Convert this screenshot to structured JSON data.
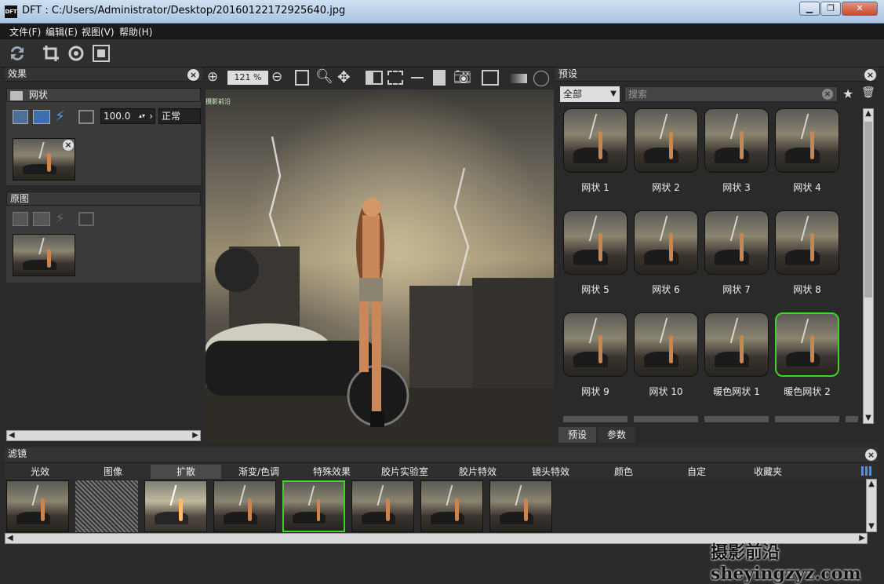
{
  "window": {
    "title": "DFT : C:/Users/Administrator/Desktop/20160122172925640.jpg",
    "app_logo": "DFT",
    "min_label": "▁",
    "max_label": "❐",
    "close_label": "✕"
  },
  "menu": [
    "文件(F)",
    "编辑(E)",
    "视图(V)",
    "帮助(H)"
  ],
  "effects_panel": {
    "title": "效果",
    "layer1": {
      "name": "网状",
      "opacity": "100.0",
      "blend": "正常"
    },
    "layer2": {
      "name": "原图"
    }
  },
  "viewer": {
    "zoom": "121 %",
    "watermark": "摄影前沿"
  },
  "presets_panel": {
    "title": "预设",
    "filter_selected": "全部",
    "search_placeholder": "搜索",
    "items": [
      {
        "label": "网状 1"
      },
      {
        "label": "网状 2"
      },
      {
        "label": "网状 3"
      },
      {
        "label": "网状 4"
      },
      {
        "label": "网状 5"
      },
      {
        "label": "网状 6"
      },
      {
        "label": "网状 7"
      },
      {
        "label": "网状 8"
      },
      {
        "label": "网状 9"
      },
      {
        "label": "网状 10"
      },
      {
        "label": "暖色网状 1"
      },
      {
        "label": "暖色网状 2"
      }
    ],
    "selected": "暖色网状 2",
    "tabs": [
      "预设",
      "参数"
    ]
  },
  "filters_panel": {
    "title": "滤镜",
    "categories": [
      "光效",
      "图像",
      "扩散",
      "渐变/色调",
      "特殊效果",
      "胶片实验室",
      "胶片特效",
      "镜头特效",
      "颜色",
      "自定",
      "收藏夹"
    ],
    "active_category": "扩散"
  },
  "footer_watermark": "摄影前沿 sheyingzyz.com",
  "colors": {
    "selection": "#3ed22a",
    "lightning": "#e8e4d8"
  }
}
